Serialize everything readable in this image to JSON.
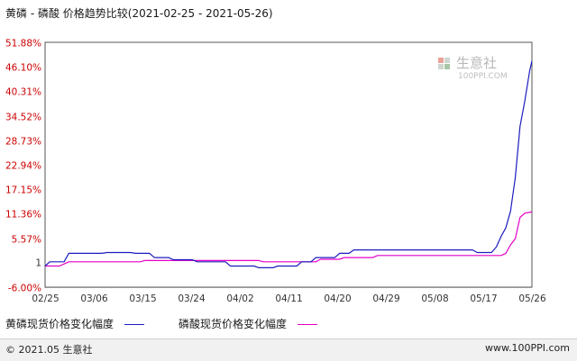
{
  "title": "黄磷 - 磷酸 价格趋势比较(2021-02-25 - 2021-05-26)",
  "colors": {
    "series1": "#1c1cbf",
    "series2": "#e600c8",
    "ytick": "#cc0000",
    "grid": "#d9d9d9",
    "axis": "#555555",
    "baseline": "#8a8a8a"
  },
  "chart_data": {
    "type": "line",
    "title": "黄磷 - 磷酸 价格趋势比较(2021-02-25 - 2021-05-26)",
    "ylabel": "",
    "xlabel": "",
    "ylim": [
      -6.0,
      51.88
    ],
    "yticks": [
      {
        "value": 51.88,
        "label": "51.88%"
      },
      {
        "value": 46.1,
        "label": "46.10%"
      },
      {
        "value": 40.31,
        "label": "40.31%"
      },
      {
        "value": 34.52,
        "label": "34.52%"
      },
      {
        "value": 28.73,
        "label": "28.73%"
      },
      {
        "value": 22.94,
        "label": "22.94%"
      },
      {
        "value": 17.15,
        "label": "17.15%"
      },
      {
        "value": 11.36,
        "label": "11.36%"
      },
      {
        "value": 5.57,
        "label": "5.57%"
      },
      {
        "value": 0,
        "label": "1"
      },
      {
        "value": -6.0,
        "label": "-6.00%"
      }
    ],
    "xticks": [
      "02/25",
      "03/06",
      "03/15",
      "03/24",
      "04/02",
      "04/11",
      "04/20",
      "04/29",
      "05/08",
      "05/17",
      "05/26"
    ],
    "grid": true,
    "legend_position": "bottom",
    "series": [
      {
        "name": "黄磷现货价格变化幅度",
        "points": [
          [
            0,
            -1.0
          ],
          [
            1,
            0.0
          ],
          [
            4,
            0.0
          ],
          [
            5,
            2.0
          ],
          [
            12,
            2.0
          ],
          [
            13,
            2.2
          ],
          [
            18,
            2.2
          ],
          [
            19,
            2.0
          ],
          [
            22,
            2.0
          ],
          [
            23,
            1.0
          ],
          [
            26,
            1.0
          ],
          [
            27,
            0.5
          ],
          [
            31,
            0.5
          ],
          [
            32,
            0.0
          ],
          [
            38,
            0.0
          ],
          [
            39,
            -1.0
          ],
          [
            44,
            -1.0
          ],
          [
            45,
            -1.4
          ],
          [
            48,
            -1.4
          ],
          [
            49,
            -1.0
          ],
          [
            53,
            -1.0
          ],
          [
            54,
            0.0
          ],
          [
            56,
            0.0
          ],
          [
            57,
            1.0
          ],
          [
            61,
            1.0
          ],
          [
            62,
            2.0
          ],
          [
            64,
            2.0
          ],
          [
            65,
            2.8
          ],
          [
            90,
            2.8
          ],
          [
            91,
            2.2
          ],
          [
            94,
            2.2
          ],
          [
            95,
            3.5
          ],
          [
            96,
            6.0
          ],
          [
            97,
            8.0
          ],
          [
            98,
            12.0
          ],
          [
            99,
            20.0
          ],
          [
            100,
            32.0
          ],
          [
            101,
            38.0
          ],
          [
            102,
            45.0
          ],
          [
            102.5,
            47.5
          ]
        ]
      },
      {
        "name": "磷酸现货价格变化幅度",
        "points": [
          [
            0,
            -1.0
          ],
          [
            3,
            -1.0
          ],
          [
            4,
            -0.5
          ],
          [
            5,
            0.0
          ],
          [
            20,
            0.0
          ],
          [
            21,
            0.3
          ],
          [
            45,
            0.3
          ],
          [
            46,
            0.0
          ],
          [
            57,
            0.0
          ],
          [
            58,
            0.6
          ],
          [
            62,
            0.6
          ],
          [
            63,
            1.0
          ],
          [
            69,
            1.0
          ],
          [
            70,
            1.5
          ],
          [
            96,
            1.5
          ],
          [
            97,
            2.0
          ],
          [
            98,
            4.0
          ],
          [
            99,
            5.5
          ],
          [
            100,
            10.5
          ],
          [
            101,
            11.5
          ],
          [
            102.5,
            11.8
          ]
        ]
      }
    ],
    "x_range": [
      0,
      102.5
    ]
  },
  "legend": {
    "item1": "黄磷现货价格变化幅度",
    "item2": "磷酸现货价格变化幅度"
  },
  "watermark": {
    "text": "生意社",
    "url": "100PPI.COM"
  },
  "footer": {
    "left": "© 2021.05 生意社",
    "right": "www.100PPI.com"
  }
}
